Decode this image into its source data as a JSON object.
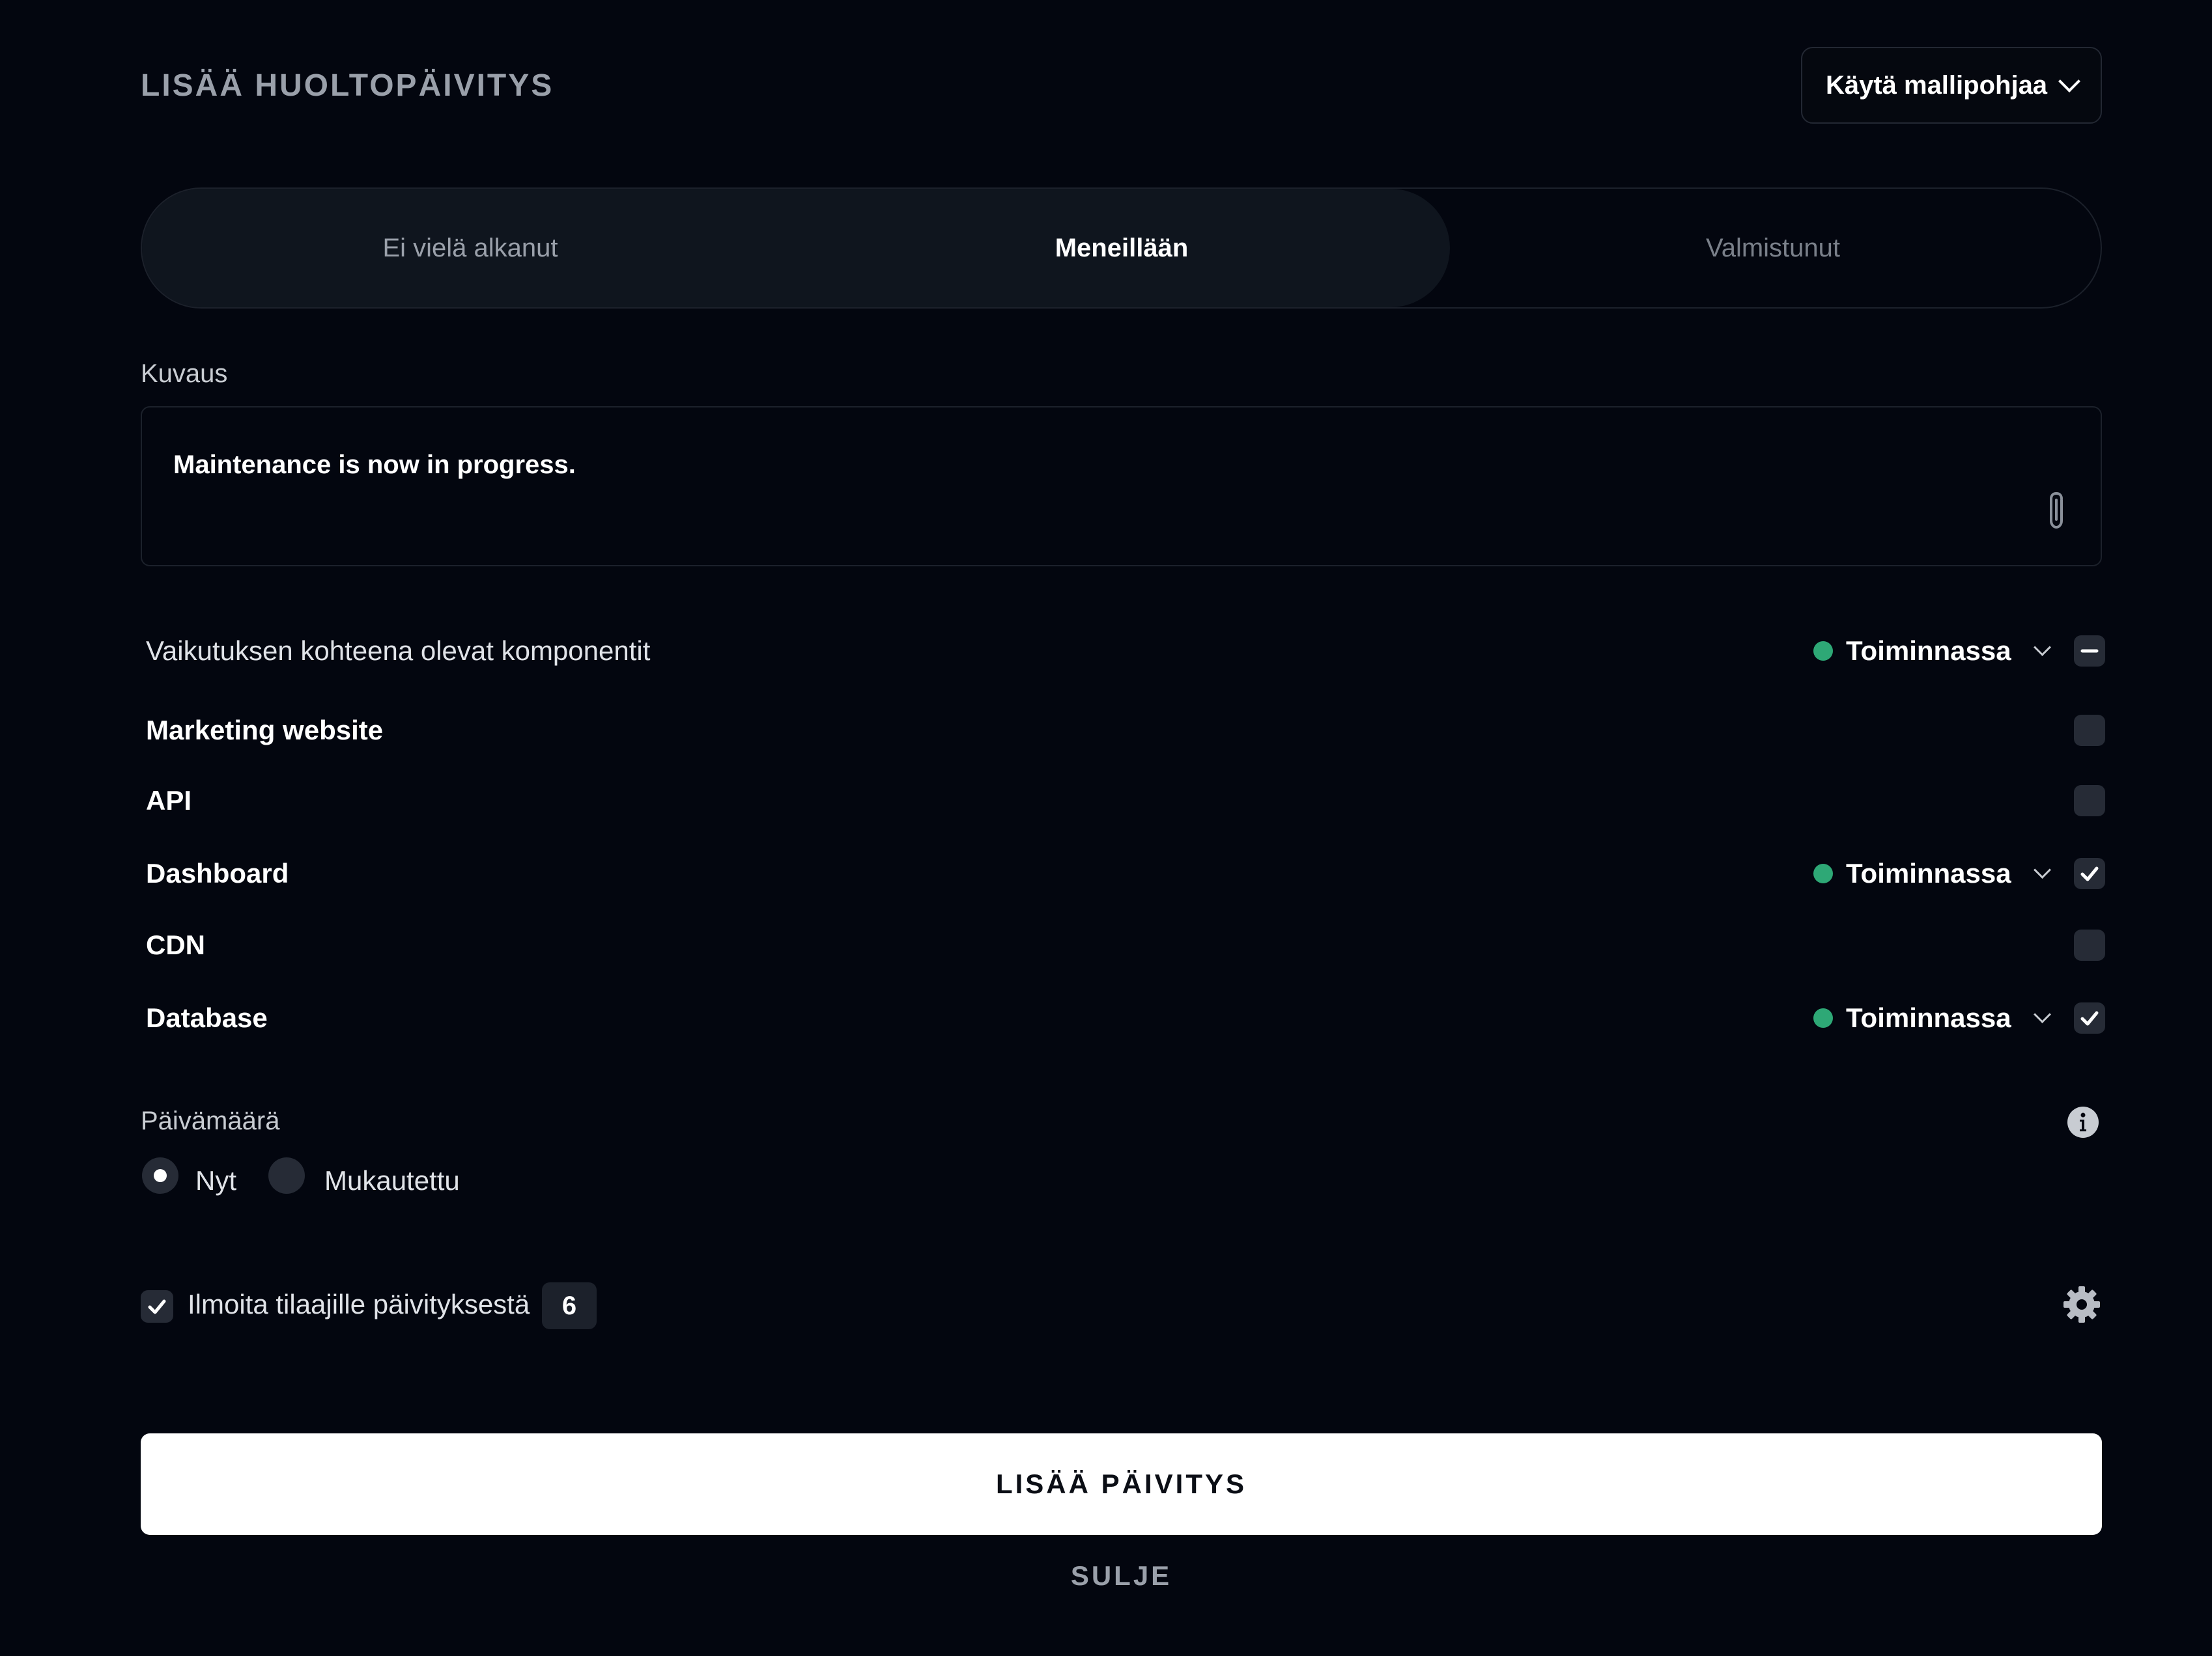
{
  "header": {
    "title": "LISÄÄ HUOLTOPÄIVITYS",
    "template_button": "Käytä mallipohjaa"
  },
  "tabs": [
    {
      "label": "Ei vielä alkanut",
      "active": false
    },
    {
      "label": "Meneillään",
      "active": true
    },
    {
      "label": "Valmistunut",
      "active": false
    }
  ],
  "description": {
    "label": "Kuvaus",
    "value": "Maintenance is now in progress."
  },
  "components": {
    "header_label": "Vaikutuksen kohteena olevat komponentit",
    "header_status": "Toiminnassa",
    "status_color": "#2ea876",
    "items": [
      {
        "name": "Marketing website",
        "checked": false,
        "status": ""
      },
      {
        "name": "API",
        "checked": false,
        "status": ""
      },
      {
        "name": "Dashboard",
        "checked": true,
        "status": "Toiminnassa"
      },
      {
        "name": "CDN",
        "checked": false,
        "status": ""
      },
      {
        "name": "Database",
        "checked": true,
        "status": "Toiminnassa"
      }
    ]
  },
  "date": {
    "label": "Päivämäärä",
    "options": [
      "Nyt",
      "Mukautettu"
    ],
    "selected": "Nyt"
  },
  "notify": {
    "label": "Ilmoita tilaajille päivityksestä",
    "count": "6",
    "checked": true
  },
  "actions": {
    "submit": "LISÄÄ PÄIVITYS",
    "close": "SULJE"
  }
}
